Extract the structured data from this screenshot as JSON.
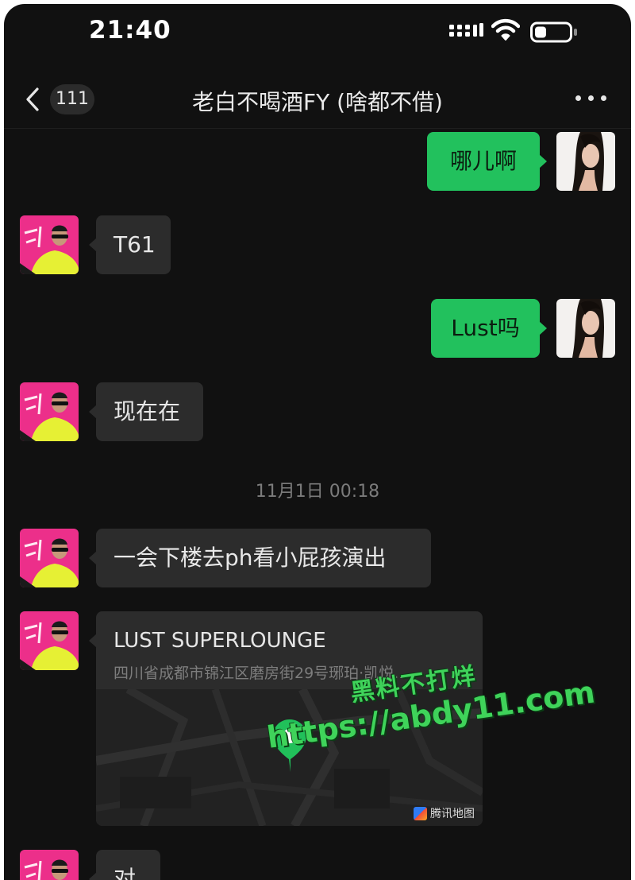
{
  "status_bar": {
    "time": "21:40"
  },
  "header": {
    "unread_count": "111",
    "title": "老白不喝酒FY (啥都不借)"
  },
  "messages": [
    {
      "sender": "self",
      "text": "哪儿啊"
    },
    {
      "sender": "other",
      "text": "T61"
    },
    {
      "sender": "self",
      "text": "Lust吗"
    },
    {
      "sender": "other",
      "text": "现在在"
    },
    {
      "sender": "other",
      "text": "一会下楼去ph看小屁孩演出"
    },
    {
      "sender": "other",
      "text": "对"
    }
  ],
  "timestamp": "11月1日 00:18",
  "location_card": {
    "name": "LUST SUPERLOUNGE",
    "address": "四川省成都市锦江区磨房街29号琊珀·凯悦...",
    "map_provider": "腾讯地图"
  },
  "watermark": {
    "line1": "黑料不打烊",
    "line2": "https://abdy11.com"
  },
  "colors": {
    "background": "#111111",
    "incoming_bubble": "#2c2c2c",
    "outgoing_bubble": "#22c15d",
    "watermark": "#3fd35a"
  },
  "icons": {
    "back": "chevron-left-icon",
    "more": "more-dots-icon",
    "signal": "signal-icon",
    "wifi": "wifi-icon",
    "battery": "battery-icon",
    "location_pin": "location-pin-icon"
  }
}
